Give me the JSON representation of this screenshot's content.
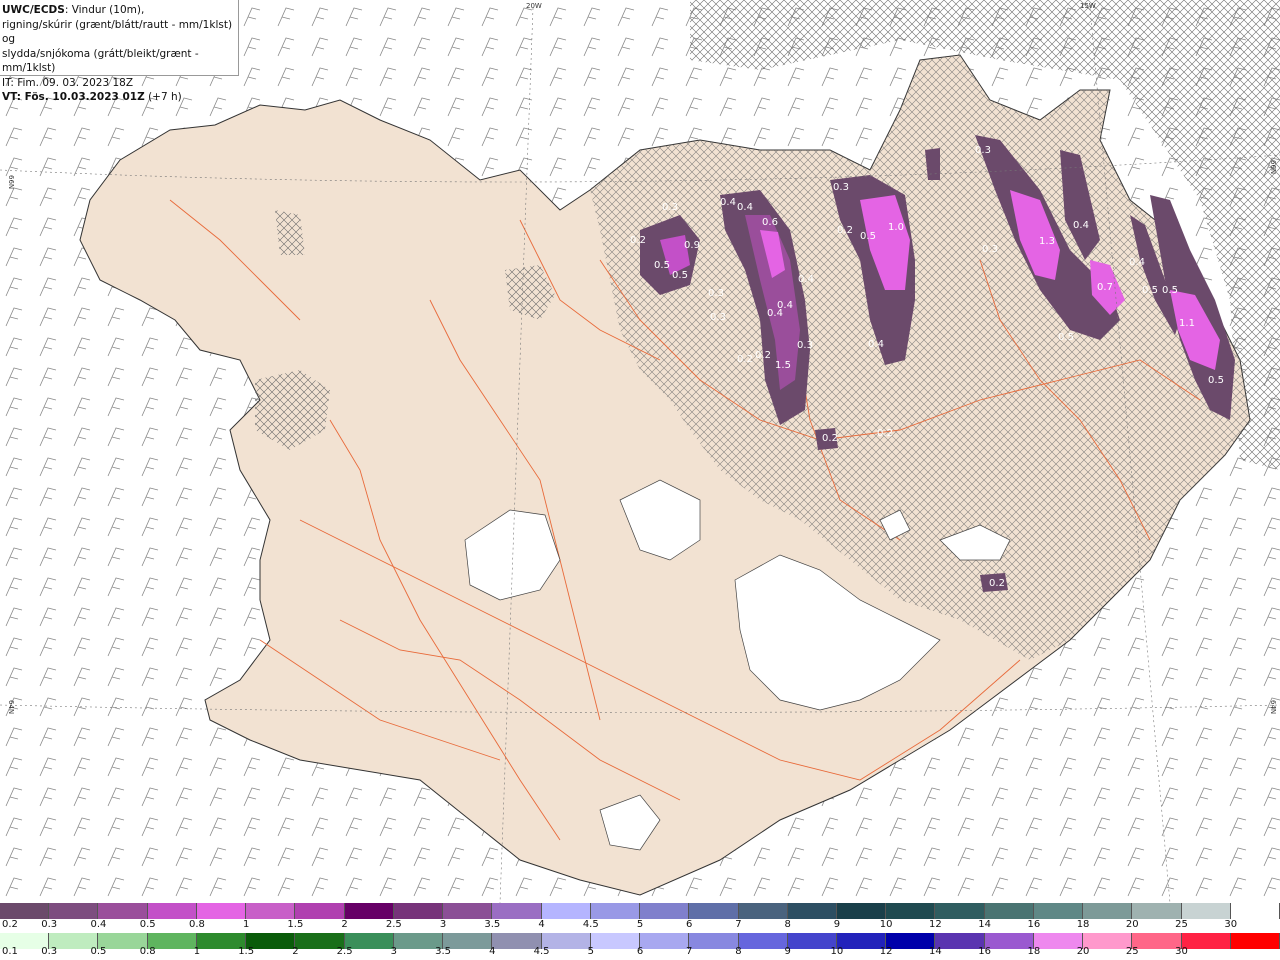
{
  "title_block": {
    "line1_bold": "UWC/ECDS",
    "line1_rest": ": Vindur (10m),",
    "line2": "rigning/skúrir (grænt/blátt/rautt - mm/1klst) og",
    "line3": "slydda/snjókoma (grátt/bleikt/grænt - mm/1klst)",
    "line4": "IT: Fim. 09. 03. 2023 18Z",
    "line5_bold": "VT: Fös. 10.03.2023 01Z",
    "line5_rest": " (+7 h)"
  },
  "graticule": {
    "top_20w": "20W",
    "top_15w": "15W",
    "left_66n": "66N",
    "right_66n": "66N",
    "left_64n": "64N",
    "right_64n": "64N"
  },
  "precip_labels": [
    "0.2",
    "0.5",
    "0.9",
    "0.5",
    "0.3",
    "0.3",
    "0.4",
    "0.4",
    "0.4",
    "0.6",
    "0.4",
    "0.4",
    "0.3",
    "0.2",
    "0.2",
    "1.5",
    "0.3",
    "0.5",
    "1.0",
    "0.3",
    "0.2",
    "0.4",
    "0.2",
    "0.2",
    "0.3",
    "0.3",
    "1.3",
    "0.4",
    "0.7",
    "0.5",
    "0.5",
    "0.4",
    "0.5",
    "1.1",
    "0.5",
    "0.2"
  ],
  "snow_scale": {
    "labels": [
      "0.2",
      "0.3",
      "0.4",
      "0.5",
      "0.8",
      "1",
      "1.5",
      "2",
      "2.5",
      "3",
      "3.5",
      "4",
      "4.5",
      "5",
      "6",
      "7",
      "8",
      "9",
      "10",
      "12",
      "14",
      "16",
      "18",
      "20",
      "25",
      "30"
    ],
    "colors": [
      "#6b4a6b",
      "#7d4d7f",
      "#9a4e9b",
      "#c350c8",
      "#e464e4",
      "#c85fc8",
      "#b040b0",
      "#660066",
      "#77337a",
      "#8b4f96",
      "#9a6ec3",
      "#b5b5ff",
      "#9999e6",
      "#8080cc",
      "#5f6fa8",
      "#4a637e",
      "#2d4f63",
      "#1a3f4a",
      "#1f4a50",
      "#2f5d60",
      "#4a7472",
      "#5f8886",
      "#7d9a98",
      "#9fb2b0",
      "#c8d3d3",
      "#ffffff"
    ]
  },
  "rain_scale": {
    "labels": [
      "0.1",
      "0.3",
      "0.5",
      "0.8",
      "1",
      "1.5",
      "2",
      "2.5",
      "3",
      "3.5",
      "4",
      "4.5",
      "5",
      "6",
      "7",
      "8",
      "9",
      "10",
      "12",
      "14",
      "16",
      "18",
      "20",
      "25",
      "30"
    ],
    "colors": [
      "#e6ffe6",
      "#bfecbf",
      "#99d699",
      "#5fb55f",
      "#2e8b2e",
      "#0a5c0a",
      "#196f19",
      "#3a8f5a",
      "#6b9a8a",
      "#7c9a9a",
      "#9090b0",
      "#b3b3e6",
      "#c8c8ff",
      "#a8a8f0",
      "#8888e0",
      "#6666dd",
      "#4444cc",
      "#2222bb",
      "#0000aa",
      "#5a34b0",
      "#9a59d0",
      "#ee88ee",
      "#ff99cc",
      "#ff6688",
      "#ff2244",
      "#ff0000"
    ]
  },
  "colors": {
    "land": "#f2e2d2",
    "land_outline": "#333333",
    "roads": "#e86a3a",
    "glacier": "#ffffff",
    "wind_barbs": "#888888"
  }
}
